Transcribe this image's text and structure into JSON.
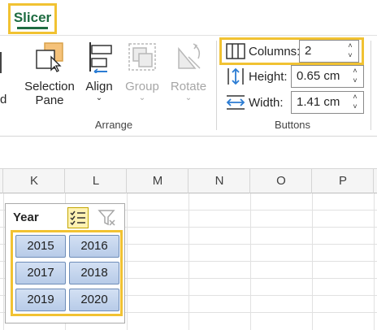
{
  "tab": {
    "label": "Slicer"
  },
  "ribbon": {
    "left_partial_label": "d",
    "selection_pane": {
      "line1": "Selection",
      "line2": "Pane"
    },
    "align": {
      "label": "Align"
    },
    "group": {
      "label": "Group"
    },
    "rotate": {
      "label": "Rotate"
    },
    "arrange_label": "Arrange",
    "buttons_label": "Buttons",
    "columns": {
      "label": "Columns:",
      "value": "2"
    },
    "height": {
      "label": "Height:",
      "value": "0.65 cm"
    },
    "width": {
      "label": "Width:",
      "value": "1.41 cm"
    }
  },
  "columns": [
    "K",
    "L",
    "M",
    "N",
    "O",
    "P"
  ],
  "slicer": {
    "title": "Year",
    "items": [
      "2015",
      "2016",
      "2017",
      "2018",
      "2019",
      "2020"
    ]
  },
  "colors": {
    "accent_green": "#1e6c41",
    "highlight": "#f1c232",
    "item_fill": "#c5d5ee"
  }
}
